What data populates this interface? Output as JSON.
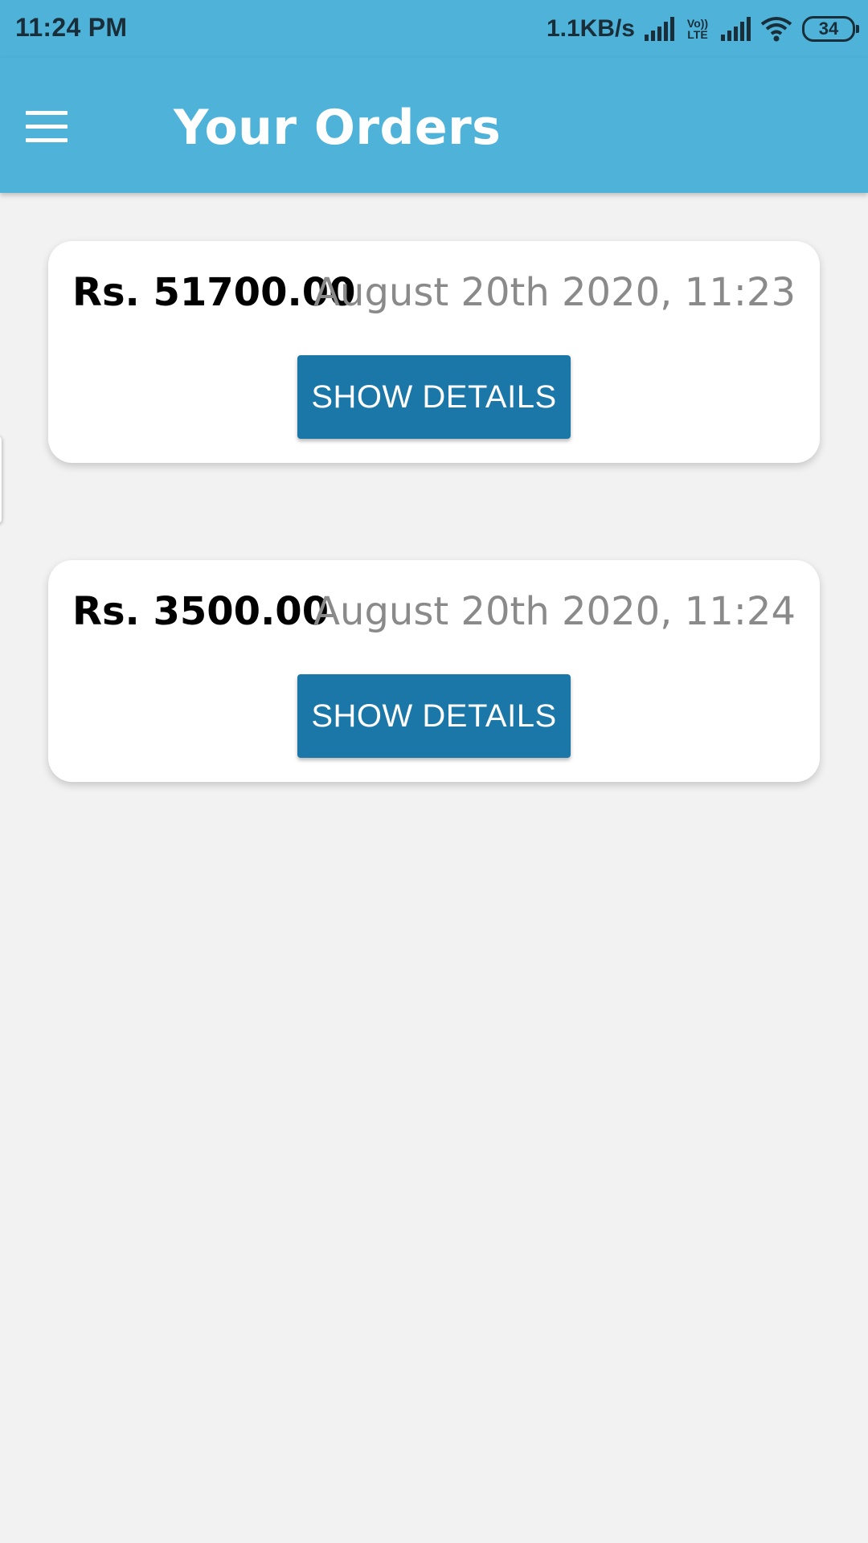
{
  "status_bar": {
    "time": "11:24 PM",
    "net_speed": "1.1KB/s",
    "volte_label": "Vo))\nLTE",
    "battery_level": "34",
    "icons": [
      "signal-icon",
      "volte-icon",
      "signal-icon",
      "wifi-icon",
      "battery-icon"
    ]
  },
  "app_bar": {
    "title": "Your Orders",
    "menu_icon": "hamburger-menu-icon",
    "background_color": "#4fb3d9"
  },
  "orders": [
    {
      "amount": "Rs. 51700.00",
      "date": "August 20th 2020, 11:23",
      "button_label": "SHOW DETAILS"
    },
    {
      "amount": "Rs. 3500.00",
      "date": "August 20th 2020, 11:24",
      "button_label": "SHOW DETAILS"
    }
  ],
  "colors": {
    "accent": "#4fb3d9",
    "button": "#1a77a8",
    "background": "#f2f2f2",
    "date_text": "#8a8a8a"
  }
}
